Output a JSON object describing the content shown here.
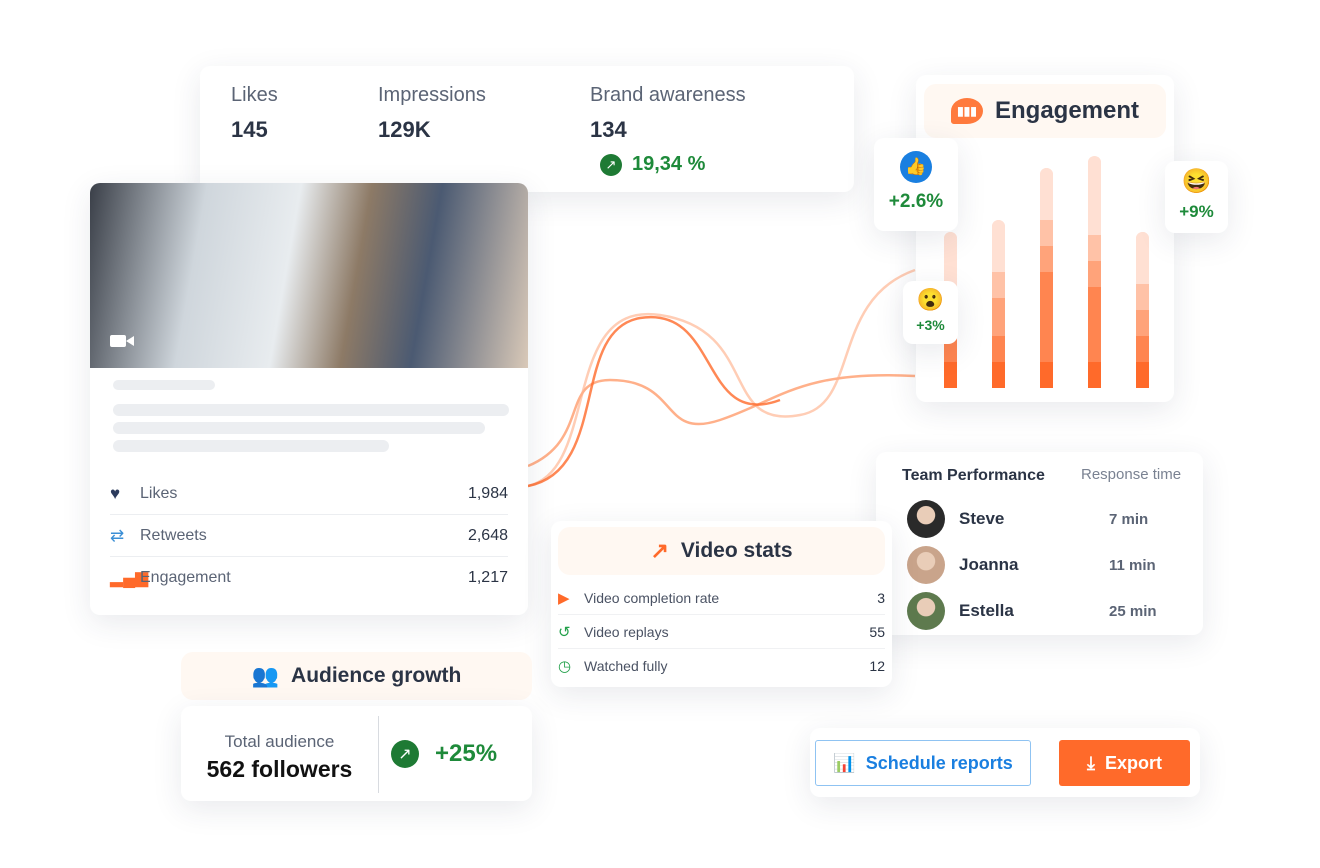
{
  "top_stats": [
    {
      "label": "Likes",
      "value": "145"
    },
    {
      "label": "Impressions",
      "value": "129K"
    },
    {
      "label": "Brand awareness",
      "value": "134",
      "change": "19,34 %"
    }
  ],
  "post": {
    "stats": [
      {
        "icon": "heart-icon",
        "label": "Likes",
        "value": "1,984",
        "color": "#2b3a5c"
      },
      {
        "icon": "retweet-icon",
        "label": "Retweets",
        "value": "2,648",
        "color": "#3b8fd6"
      },
      {
        "icon": "bar-chart-icon",
        "label": "Engagement",
        "value": "1,217",
        "color": "#ff6a2a"
      }
    ]
  },
  "engagement": {
    "title": "Engagement",
    "reactions": [
      {
        "icon": "thumbs-up-icon",
        "value": "+2.6%"
      },
      {
        "icon": "wow-emoji-icon",
        "value": "+3%"
      },
      {
        "icon": "laugh-emoji-icon",
        "value": "+9%"
      }
    ]
  },
  "team": {
    "title": "Team Performance",
    "col": "Response time",
    "members": [
      {
        "name": "Steve",
        "time": "7 min"
      },
      {
        "name": "Joanna",
        "time": "11 min"
      },
      {
        "name": "Estella",
        "time": "25 min"
      }
    ]
  },
  "video": {
    "title": "Video stats",
    "rows": [
      {
        "icon": "play-icon",
        "label": "Video completion rate",
        "value": "3"
      },
      {
        "icon": "replay-icon",
        "label": "Video replays",
        "value": "55"
      },
      {
        "icon": "clock-icon",
        "label": "Watched fully",
        "value": "12"
      }
    ]
  },
  "audience": {
    "title": "Audience growth",
    "label": "Total audience",
    "value": "562 followers",
    "change": "+25%"
  },
  "actions": {
    "schedule": "Schedule reports",
    "export": "Export"
  },
  "colors": {
    "accent": "#ff6a2a",
    "green": "#1e8a3a",
    "blue": "#1a7fe0"
  }
}
